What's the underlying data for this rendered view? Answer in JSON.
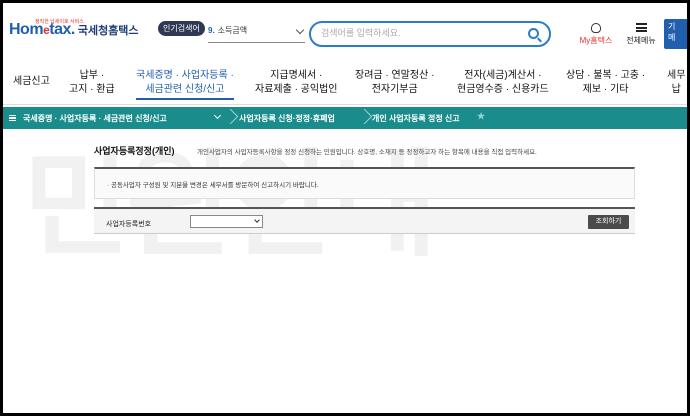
{
  "header": {
    "logo_tagline": "정직한 납세이호 서비스",
    "logo_brand_a": "Hom",
    "logo_brand_e": "e",
    "logo_brand_b": "tax.",
    "logo_ko": "국세청홈택스",
    "popular_label": "인기검색어",
    "popular_rank": "9.",
    "popular_term": "소득금액",
    "search_placeholder": "검색어를 입력하세요.",
    "myhome_label": "My홈택스",
    "allmenu_label": "전체메뉴",
    "blue_btn_l1": "기",
    "blue_btn_l2": "메"
  },
  "gnb": [
    {
      "l1": "세금신고",
      "l2": ""
    },
    {
      "l1": "납부 ·",
      "l2": "고지 · 환급"
    },
    {
      "l1": "국세증명 · 사업자등록 ·",
      "l2": "세금관련 신청/신고"
    },
    {
      "l1": "지급명세서 ·",
      "l2": "자료제출 · 공익법인"
    },
    {
      "l1": "장려금 · 연말정산 ·",
      "l2": "전자기부금"
    },
    {
      "l1": "전자(세금)계산서 ·",
      "l2": "현금영수증 · 신용카드"
    },
    {
      "l1": "상담 · 불복 · 고충 ·",
      "l2": "제보 · 기타"
    },
    {
      "l1": "세무",
      "l2": "납"
    }
  ],
  "breadcrumb": {
    "c1": "국세증명 · 사업자등록 · 세금관련 신청/신고",
    "c2": "사업자등록 신청·정정·휴폐업",
    "c3": "개인 사업자등록 정정 신고"
  },
  "watermark": "민원안내",
  "content": {
    "title": "사업자등록정정(개인)",
    "desc": "개인사업자의 사업자등록사항을 정정 신청하는 민원입니다. 상호명, 소재지 등 정정하고자 하는 항목에 내용을 직접 입력하세요.",
    "notice": "· 공동사업자 구성원 및 지분율 변경은 세무서를 방문하여 신고하시기 바랍니다.",
    "form_label": "사업자등록번호",
    "select_value": "",
    "search_button": "조회하기"
  }
}
